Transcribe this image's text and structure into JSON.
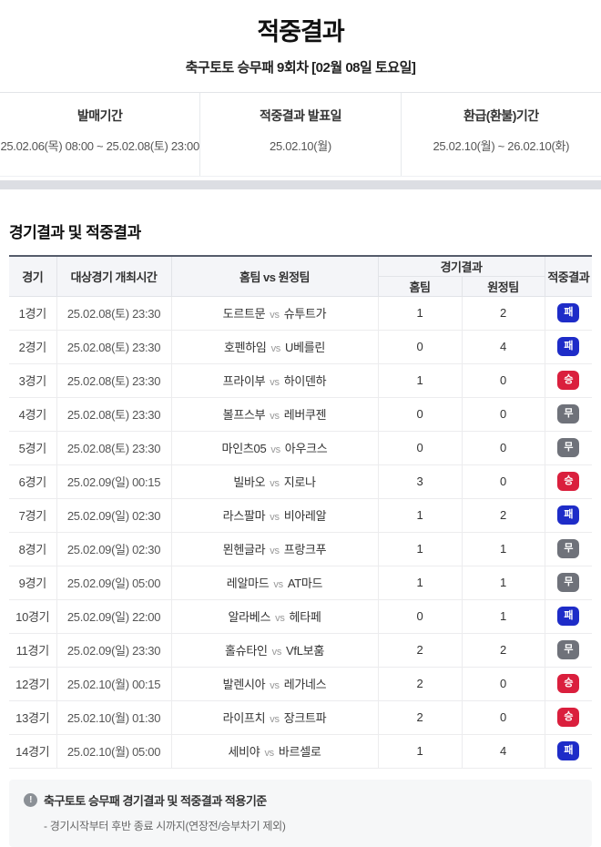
{
  "page": {
    "title": "적중결과",
    "subtitle": "축구토토 승무패 9회차 [02월 08일 토요일]"
  },
  "summary": {
    "items": [
      {
        "label": "발매기간",
        "value": "25.02.06(목) 08:00 ~ 25.02.08(토) 23:00"
      },
      {
        "label": "적중결과 발표일",
        "value": "25.02.10(월)"
      },
      {
        "label": "환급(환불)기간",
        "value": "25.02.10(월) ~ 26.02.10(화)"
      }
    ]
  },
  "section": {
    "title": "경기결과 및 적중결과"
  },
  "table": {
    "headers": {
      "game": "경기",
      "datetime": "대상경기 개최시간",
      "teams": "홈팀 vs 원정팀",
      "result_group": "경기결과",
      "home": "홈팀",
      "away": "원정팀",
      "hit": "적중결과"
    },
    "vs_label": "vs",
    "rows": [
      {
        "no": "1경기",
        "time": "25.02.08(토) 23:30",
        "home_team": "도르트문",
        "away_team": "슈투트가",
        "home_score": "1",
        "away_score": "2",
        "result": "패",
        "result_type": "lose"
      },
      {
        "no": "2경기",
        "time": "25.02.08(토) 23:30",
        "home_team": "호펜하임",
        "away_team": "U베를린",
        "home_score": "0",
        "away_score": "4",
        "result": "패",
        "result_type": "lose"
      },
      {
        "no": "3경기",
        "time": "25.02.08(토) 23:30",
        "home_team": "프라이부",
        "away_team": "하이덴하",
        "home_score": "1",
        "away_score": "0",
        "result": "승",
        "result_type": "win"
      },
      {
        "no": "4경기",
        "time": "25.02.08(토) 23:30",
        "home_team": "볼프스부",
        "away_team": "레버쿠젠",
        "home_score": "0",
        "away_score": "0",
        "result": "무",
        "result_type": "draw"
      },
      {
        "no": "5경기",
        "time": "25.02.08(토) 23:30",
        "home_team": "마인츠05",
        "away_team": "아우크스",
        "home_score": "0",
        "away_score": "0",
        "result": "무",
        "result_type": "draw"
      },
      {
        "no": "6경기",
        "time": "25.02.09(일) 00:15",
        "home_team": "빌바오",
        "away_team": "지로나",
        "home_score": "3",
        "away_score": "0",
        "result": "승",
        "result_type": "win"
      },
      {
        "no": "7경기",
        "time": "25.02.09(일) 02:30",
        "home_team": "라스팔마",
        "away_team": "비아레알",
        "home_score": "1",
        "away_score": "2",
        "result": "패",
        "result_type": "lose"
      },
      {
        "no": "8경기",
        "time": "25.02.09(일) 02:30",
        "home_team": "묀헨글라",
        "away_team": "프랑크푸",
        "home_score": "1",
        "away_score": "1",
        "result": "무",
        "result_type": "draw"
      },
      {
        "no": "9경기",
        "time": "25.02.09(일) 05:00",
        "home_team": "레알마드",
        "away_team": "AT마드",
        "home_score": "1",
        "away_score": "1",
        "result": "무",
        "result_type": "draw"
      },
      {
        "no": "10경기",
        "time": "25.02.09(일) 22:00",
        "home_team": "알라베스",
        "away_team": "헤타페",
        "home_score": "0",
        "away_score": "1",
        "result": "패",
        "result_type": "lose"
      },
      {
        "no": "11경기",
        "time": "25.02.09(일) 23:30",
        "home_team": "홀슈타인",
        "away_team": "VfL보훔",
        "home_score": "2",
        "away_score": "2",
        "result": "무",
        "result_type": "draw"
      },
      {
        "no": "12경기",
        "time": "25.02.10(월) 00:15",
        "home_team": "발렌시아",
        "away_team": "레가네스",
        "home_score": "2",
        "away_score": "0",
        "result": "승",
        "result_type": "win"
      },
      {
        "no": "13경기",
        "time": "25.02.10(월) 01:30",
        "home_team": "라이프치",
        "away_team": "장크트파",
        "home_score": "2",
        "away_score": "0",
        "result": "승",
        "result_type": "win"
      },
      {
        "no": "14경기",
        "time": "25.02.10(월) 05:00",
        "home_team": "세비야",
        "away_team": "바르셀로",
        "home_score": "1",
        "away_score": "4",
        "result": "패",
        "result_type": "lose"
      }
    ]
  },
  "note": {
    "title": "축구토토 승무패 경기결과 및 적중결과 적용기준",
    "line": "- 경기시작부터 후반 종료 시까지(연장전/승부차기 제외)",
    "icon_glyph": "!"
  },
  "colors": {
    "win_badge": "#da1f3d",
    "draw_badge": "#6f727a",
    "lose_badge": "#1e2cc8",
    "table_top_border": "#555c6b",
    "divider_bar": "#dcdee3"
  }
}
